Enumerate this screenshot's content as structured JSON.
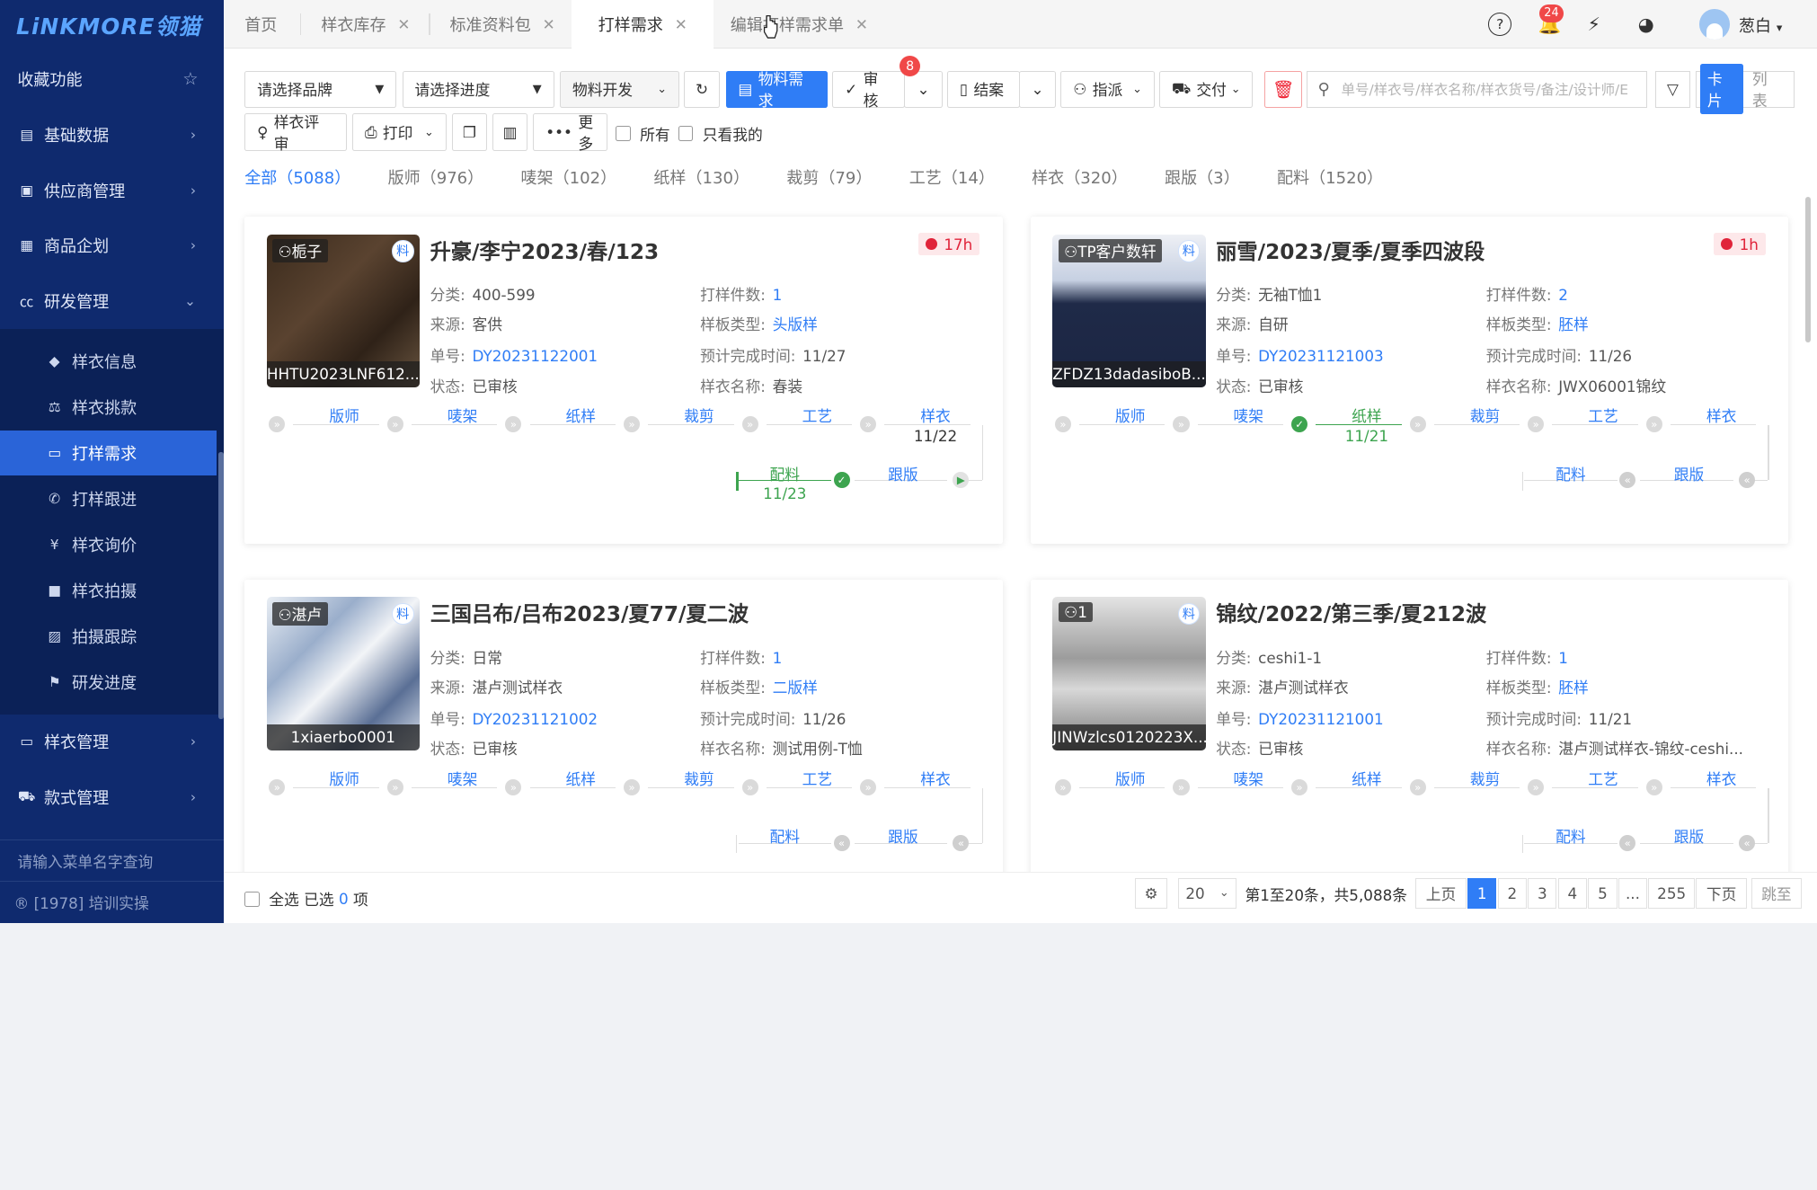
{
  "logo": "LiNKMORE领猫",
  "sidebar": {
    "favorites": "收藏功能",
    "groups": [
      {
        "label": "基础数据"
      },
      {
        "label": "供应商管理"
      },
      {
        "label": "商品企划"
      },
      {
        "label": "研发管理"
      }
    ],
    "sub_items": [
      {
        "label": "样衣信息"
      },
      {
        "label": "样衣挑款"
      },
      {
        "label": "打样需求"
      },
      {
        "label": "打样跟进"
      },
      {
        "label": "样衣询价"
      },
      {
        "label": "样衣拍摄"
      },
      {
        "label": "拍摄跟踪"
      },
      {
        "label": "研发进度"
      }
    ],
    "groups_after": [
      {
        "label": "样衣管理"
      },
      {
        "label": "款式管理"
      }
    ],
    "search_placeholder": "请输入菜单名字查询",
    "footer": "® [1978] 培训实操"
  },
  "tabs": [
    {
      "label": "首页"
    },
    {
      "label": "样衣库存"
    },
    {
      "label": "标准资料包"
    },
    {
      "label": "打样需求"
    },
    {
      "label": "编辑打样需求单"
    }
  ],
  "header": {
    "notif_count": "24",
    "username": "葱白"
  },
  "toolbar": {
    "brand_select": "请选择品牌",
    "progress_select": "请选择进度",
    "material_select": "物料开发",
    "material_btn": "物料需求",
    "audit_btn": "审核",
    "audit_badge": "8",
    "close_btn": "结案",
    "assign_btn": "指派",
    "deliver_btn": "交付",
    "search_placeholder": "单号/样衣号/样衣名称/样衣货号/备注/设计师/E",
    "view_card": "卡片",
    "view_list": "列表",
    "review_btn": "样衣评审",
    "print_btn": "打印",
    "more_btn": "更多",
    "all_label": "所有",
    "mine_label": "只看我的"
  },
  "status_tabs": [
    {
      "label": "全部（5088）"
    },
    {
      "label": "版师（976）"
    },
    {
      "label": "唛架（102）"
    },
    {
      "label": "纸样（130）"
    },
    {
      "label": "裁剪（79）"
    },
    {
      "label": "工艺（14）"
    },
    {
      "label": "样衣（320）"
    },
    {
      "label": "跟版（3）"
    },
    {
      "label": "配料（1520）"
    }
  ],
  "field_labels": {
    "category": "分类:",
    "count": "打样件数:",
    "source": "来源:",
    "pattern_type": "样板类型:",
    "order_no": "单号:",
    "eta": "预计完成时间:",
    "status": "状态:",
    "sample_name": "样衣名称:"
  },
  "stage_labels": [
    "版师",
    "唛架",
    "纸样",
    "裁剪",
    "工艺",
    "样衣"
  ],
  "stage_extra": [
    "配料",
    "跟版"
  ],
  "cards": [
    {
      "tag": "栀子",
      "liao": "料",
      "code": "HHTU2023LNF612...",
      "title": "升豪/李宁2023/春/123",
      "timer": "17h",
      "category": "400-599",
      "count": "1",
      "source": "客供",
      "pattern_type": "头版样",
      "order_no": "DY20231122001",
      "eta": "11/27",
      "status": "已审核",
      "sample_name": "春装",
      "sample_date": "11/22",
      "peiliao_date": "11/23"
    },
    {
      "tag": "TP客户数轩",
      "liao": "料",
      "code": "ZFDZ13dadasiboB...",
      "title": "丽雪/2023/夏季/夏季四波段",
      "timer": "1h",
      "category": "无袖T恤1",
      "count": "2",
      "source": "自研",
      "pattern_type": "胚样",
      "order_no": "DY20231121003",
      "eta": "11/26",
      "status": "已审核",
      "sample_name": "JWX06001锦纹",
      "paper_date": "11/21"
    },
    {
      "tag": "湛卢",
      "liao": "料",
      "code": "1xiaerbo0001",
      "title": "三国吕布/吕布2023/夏77/夏二波",
      "category": "日常",
      "count": "1",
      "source": "湛卢测试样衣",
      "pattern_type": "二版样",
      "order_no": "DY20231121002",
      "eta": "11/26",
      "status": "已审核",
      "sample_name": "测试用例-T恤"
    },
    {
      "tag": "1",
      "liao": "料",
      "code": "JINWzlcs0120223X...",
      "title": "锦纹/2022/第三季/夏212波",
      "category": "ceshi1-1",
      "count": "1",
      "source": "湛卢测试样衣",
      "pattern_type": "胚样",
      "order_no": "DY20231121001",
      "eta": "11/21",
      "status": "已审核",
      "sample_name": "湛卢测试样衣-锦纹-ceshi..."
    }
  ],
  "footer": {
    "select_all": "全选",
    "selected_prefix": "已选",
    "selected_count": "0",
    "selected_suffix": "项",
    "page_size": "20",
    "range_text": "第1至20条，共5,088条",
    "prev": "上页",
    "pages": [
      "1",
      "2",
      "3",
      "4",
      "5",
      "...",
      "255"
    ],
    "next": "下页",
    "jump": "跳至"
  },
  "colors": {
    "sidebar": "#0f2a6e",
    "accent": "#2f7df6",
    "ok": "#3da44f",
    "danger": "#e0243a"
  }
}
